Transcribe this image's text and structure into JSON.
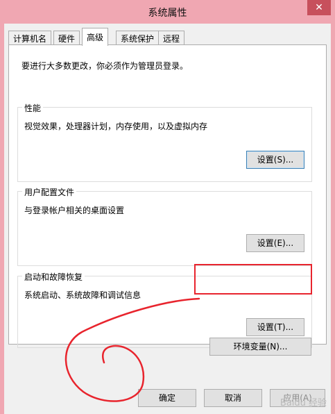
{
  "window": {
    "title": "系统属性",
    "close_label": "✕"
  },
  "tabs": [
    {
      "label": "计算机名"
    },
    {
      "label": "硬件"
    },
    {
      "label": "高级",
      "active": true
    },
    {
      "label": "系统保护"
    },
    {
      "label": "远程"
    }
  ],
  "panel": {
    "intro": "要进行大多数更改，你必须作为管理员登录。",
    "performance": {
      "legend": "性能",
      "desc": "视觉效果，处理器计划，内存使用，以及虚拟内存",
      "button": "设置(S)..."
    },
    "user_profiles": {
      "legend": "用户配置文件",
      "desc": "与登录帐户相关的桌面设置",
      "button": "设置(E)..."
    },
    "startup_recovery": {
      "legend": "启动和故障恢复",
      "desc": "系统启动、系统故障和调试信息",
      "button": "设置(T)..."
    }
  },
  "env_button": "环境变量(N)...",
  "footer": {
    "ok": "确定",
    "cancel": "取消",
    "apply": "应用(A)"
  },
  "watermark": "Baidu 经验",
  "annotation_color": "#e8242d"
}
